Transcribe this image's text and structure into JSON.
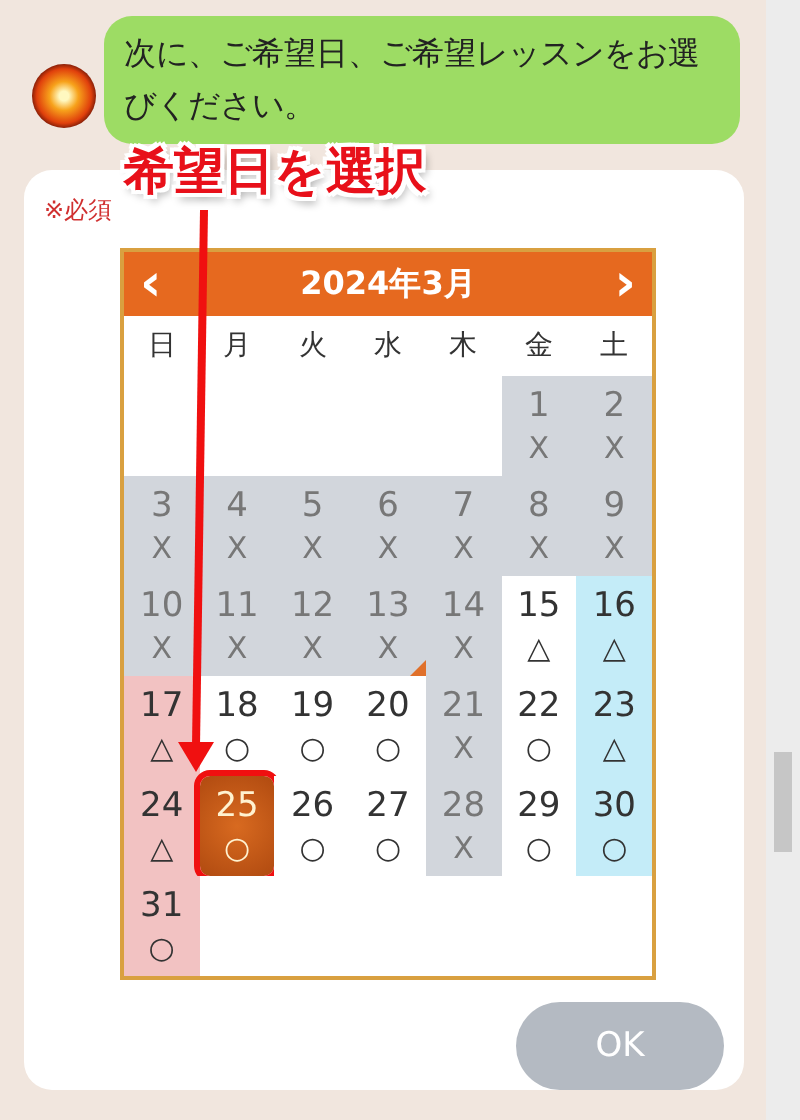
{
  "message": {
    "text": "次に、ご希望日、ご希望レッスンをお選びください。"
  },
  "form": {
    "required_label": "※必須",
    "calendar": {
      "prev": "‹",
      "title": "2024年3月",
      "next": "›",
      "weekdays": [
        "日",
        "月",
        "火",
        "水",
        "木",
        "金",
        "土"
      ],
      "weeks": [
        {
          "cells": [
            {
              "kind": "blank"
            },
            {
              "kind": "blank"
            },
            {
              "kind": "blank"
            },
            {
              "kind": "blank"
            },
            {
              "kind": "blank"
            },
            {
              "kind": "closed",
              "day": "1",
              "mark": "X",
              "selected": false,
              "today": false
            },
            {
              "kind": "closed",
              "day": "2",
              "mark": "X",
              "selected": false,
              "today": false
            }
          ]
        },
        {
          "cells": [
            {
              "kind": "closed",
              "day": "3",
              "mark": "X",
              "selected": false,
              "today": false
            },
            {
              "kind": "closed",
              "day": "4",
              "mark": "X",
              "selected": false,
              "today": false
            },
            {
              "kind": "closed",
              "day": "5",
              "mark": "X",
              "selected": false,
              "today": false
            },
            {
              "kind": "closed",
              "day": "6",
              "mark": "X",
              "selected": false,
              "today": false
            },
            {
              "kind": "closed",
              "day": "7",
              "mark": "X",
              "selected": false,
              "today": false
            },
            {
              "kind": "closed",
              "day": "8",
              "mark": "X",
              "selected": false,
              "today": false
            },
            {
              "kind": "closed",
              "day": "9",
              "mark": "X",
              "selected": false,
              "today": false
            }
          ]
        },
        {
          "cells": [
            {
              "kind": "closed",
              "day": "10",
              "mark": "X",
              "selected": false,
              "today": false
            },
            {
              "kind": "closed",
              "day": "11",
              "mark": "X",
              "selected": false,
              "today": false
            },
            {
              "kind": "closed",
              "day": "12",
              "mark": "X",
              "selected": false,
              "today": false
            },
            {
              "kind": "closed",
              "day": "13",
              "mark": "X",
              "selected": false,
              "today": true
            },
            {
              "kind": "closed",
              "day": "14",
              "mark": "X",
              "selected": false,
              "today": false
            },
            {
              "kind": "open",
              "day": "15",
              "mark": "△",
              "selected": false,
              "today": false
            },
            {
              "kind": "saturday",
              "day": "16",
              "mark": "△",
              "selected": false,
              "today": false
            }
          ]
        },
        {
          "cells": [
            {
              "kind": "sunday",
              "day": "17",
              "mark": "△",
              "selected": false,
              "today": false
            },
            {
              "kind": "open",
              "day": "18",
              "mark": "○",
              "selected": false,
              "today": false
            },
            {
              "kind": "open",
              "day": "19",
              "mark": "○",
              "selected": false,
              "today": false
            },
            {
              "kind": "open",
              "day": "20",
              "mark": "○",
              "selected": false,
              "today": false
            },
            {
              "kind": "closed",
              "day": "21",
              "mark": "X",
              "selected": false,
              "today": false
            },
            {
              "kind": "open",
              "day": "22",
              "mark": "○",
              "selected": false,
              "today": false
            },
            {
              "kind": "saturday",
              "day": "23",
              "mark": "△",
              "selected": false,
              "today": false
            }
          ]
        },
        {
          "cells": [
            {
              "kind": "sunday",
              "day": "24",
              "mark": "△",
              "selected": false,
              "today": false
            },
            {
              "kind": "open",
              "day": "25",
              "mark": "○",
              "selected": true,
              "today": false
            },
            {
              "kind": "open",
              "day": "26",
              "mark": "○",
              "selected": false,
              "today": false
            },
            {
              "kind": "open",
              "day": "27",
              "mark": "○",
              "selected": false,
              "today": false
            },
            {
              "kind": "closed",
              "day": "28",
              "mark": "X",
              "selected": false,
              "today": false
            },
            {
              "kind": "open",
              "day": "29",
              "mark": "○",
              "selected": false,
              "today": false
            },
            {
              "kind": "saturday",
              "day": "30",
              "mark": "○",
              "selected": false,
              "today": false
            }
          ]
        },
        {
          "cells": [
            {
              "kind": "sunday",
              "day": "31",
              "mark": "○",
              "selected": false,
              "today": false
            },
            {
              "kind": "blank"
            },
            {
              "kind": "blank"
            },
            {
              "kind": "blank"
            },
            {
              "kind": "blank"
            },
            {
              "kind": "blank"
            },
            {
              "kind": "blank"
            }
          ]
        }
      ]
    },
    "ok_button": {
      "label": "OK",
      "disabled": true
    }
  },
  "annotation": {
    "label": "希望日を選択"
  }
}
